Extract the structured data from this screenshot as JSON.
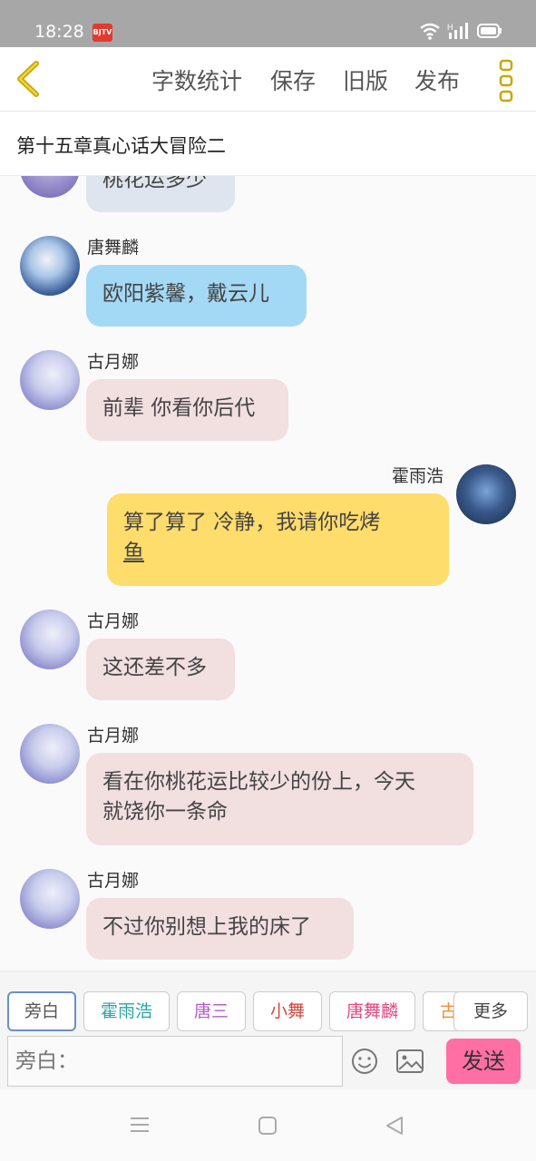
{
  "status": {
    "time": "18:28",
    "app_badge": "BJTV"
  },
  "toolbar": {
    "word_count": "字数统计",
    "save": "保存",
    "old_version": "旧版",
    "publish": "发布"
  },
  "chapter": {
    "title": "第十五章真心话大冒险二"
  },
  "messages": [
    {
      "speaker": "",
      "text": "桃花运多少",
      "side": "left"
    },
    {
      "speaker": "唐舞麟",
      "text": "欧阳紫馨，戴云儿",
      "side": "left"
    },
    {
      "speaker": "古月娜",
      "text": "前辈 你看你后代",
      "side": "left"
    },
    {
      "speaker": "霍雨浩",
      "text_line1": "算了算了 冷静，我请你吃烤",
      "text_line2": "鱼",
      "side": "right"
    },
    {
      "speaker": "古月娜",
      "text": "这还差不多",
      "side": "left"
    },
    {
      "speaker": "古月娜",
      "text_line1": "看在你桃花运比较少的份上，今天",
      "text_line2": "就饶你一条命",
      "side": "left"
    },
    {
      "speaker": "古月娜",
      "text": "不过你别想上我的床了",
      "side": "left"
    }
  ],
  "chips": [
    {
      "label": "旁白",
      "color": "#555555"
    },
    {
      "label": "霍雨浩",
      "color": "#2aa6a0"
    },
    {
      "label": "唐三",
      "color": "#b45cc8"
    },
    {
      "label": "小舞",
      "color": "#d0473a"
    },
    {
      "label": "唐舞麟",
      "color": "#e2487f"
    },
    {
      "label": "古",
      "color": "#e8913a"
    },
    {
      "label": "更多",
      "color": "#444444"
    }
  ],
  "input": {
    "placeholder": "旁白："
  },
  "send_label": "发送"
}
